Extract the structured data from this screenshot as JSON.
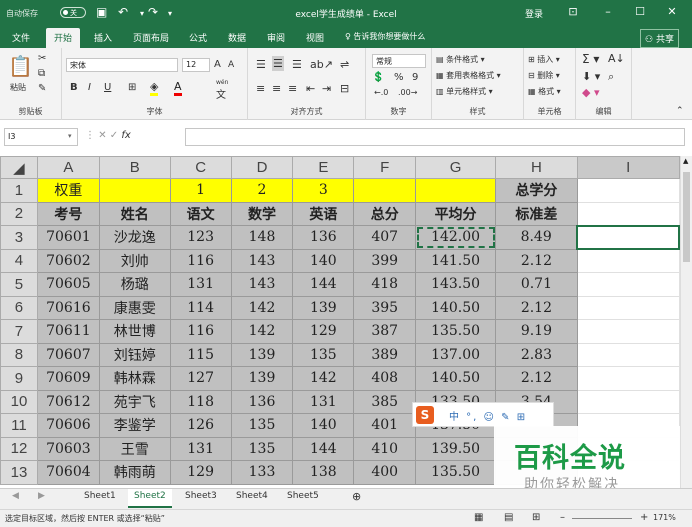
{
  "titlebar": {
    "autosave_label": "自动保存",
    "autosave_state": "关",
    "doc_title": "excel学生成绩单 - Excel",
    "login": "登录",
    "undo_icon": "undo-icon",
    "redo_icon": "redo-icon",
    "save_icon": "save-icon"
  },
  "tabs": [
    "文件",
    "开始",
    "插入",
    "页面布局",
    "公式",
    "数据",
    "审阅",
    "视图"
  ],
  "active_tab": "开始",
  "tell_me": "告诉我你想要做什么",
  "share": "共享",
  "ribbon": {
    "clipboard": {
      "label": "剪贴板",
      "paste": "粘贴"
    },
    "font": {
      "label": "字体",
      "name": "宋体",
      "size": "12",
      "bold": "B",
      "italic": "I",
      "underline": "U",
      "font_color_letter": "A",
      "wen": "wén"
    },
    "alignment": {
      "label": "对齐方式"
    },
    "number": {
      "label": "数字",
      "format": "常规",
      "percent": "%",
      "comma": "9"
    },
    "styles": {
      "label": "样式",
      "cond_format": "条件格式",
      "table_format": "套用表格格式",
      "cell_style": "单元格样式"
    },
    "cells": {
      "label": "单元格",
      "insert": "插入",
      "delete": "删除",
      "format": "格式"
    },
    "editing": {
      "label": "编辑"
    }
  },
  "formula_bar": {
    "name_box": "I3",
    "fx": "fx",
    "value": ""
  },
  "grid": {
    "columns": [
      "A",
      "B",
      "C",
      "D",
      "E",
      "F",
      "G",
      "H",
      "I"
    ],
    "row_numbers": [
      "1",
      "2",
      "3",
      "4",
      "5",
      "6",
      "7",
      "8",
      "9",
      "10",
      "11",
      "12",
      "13"
    ],
    "row1": [
      "权重",
      "",
      "1",
      "2",
      "3",
      "",
      "",
      "总学分"
    ],
    "row2": [
      "考号",
      "姓名",
      "语文",
      "数学",
      "英语",
      "总分",
      "平均分",
      "标准差"
    ],
    "data": [
      [
        "70601",
        "沙龙逸",
        "123",
        "148",
        "136",
        "407",
        "142.00",
        "8.49"
      ],
      [
        "70602",
        "刘帅",
        "116",
        "143",
        "140",
        "399",
        "141.50",
        "2.12"
      ],
      [
        "70605",
        "杨璐",
        "131",
        "143",
        "144",
        "418",
        "143.50",
        "0.71"
      ],
      [
        "70616",
        "康惠雯",
        "114",
        "142",
        "139",
        "395",
        "140.50",
        "2.12"
      ],
      [
        "70611",
        "林世博",
        "116",
        "142",
        "129",
        "387",
        "135.50",
        "9.19"
      ],
      [
        "70607",
        "刘钰婷",
        "115",
        "139",
        "135",
        "389",
        "137.00",
        "2.83"
      ],
      [
        "70609",
        "韩林霖",
        "127",
        "139",
        "142",
        "408",
        "140.50",
        "2.12"
      ],
      [
        "70612",
        "苑宇飞",
        "118",
        "136",
        "131",
        "385",
        "133.50",
        "3.54"
      ],
      [
        "70606",
        "李鉴学",
        "126",
        "135",
        "140",
        "401",
        "137.50",
        ""
      ],
      [
        "70603",
        "王雪",
        "131",
        "135",
        "144",
        "410",
        "139.50",
        ""
      ],
      [
        "70604",
        "韩雨萌",
        "129",
        "133",
        "138",
        "400",
        "135.50",
        ""
      ]
    ]
  },
  "sheets": [
    "Sheet1",
    "Sheet2",
    "Sheet3",
    "Sheet4",
    "Sheet5"
  ],
  "active_sheet": "Sheet2",
  "status": {
    "text": "选定目标区域，然后按 ENTER 或选择“粘贴”",
    "zoom": "171%"
  },
  "ime": {
    "logo": "S",
    "tools": "中 °, ☺ ✎ ⊞"
  },
  "watermark": {
    "main": "百科全说",
    "sub": "助你轻松解决"
  },
  "colors": {
    "accent": "#217346",
    "highlight": "#ffff00",
    "gray_fill": "#c0c0c0",
    "watermark_green": "#1d9a47"
  }
}
